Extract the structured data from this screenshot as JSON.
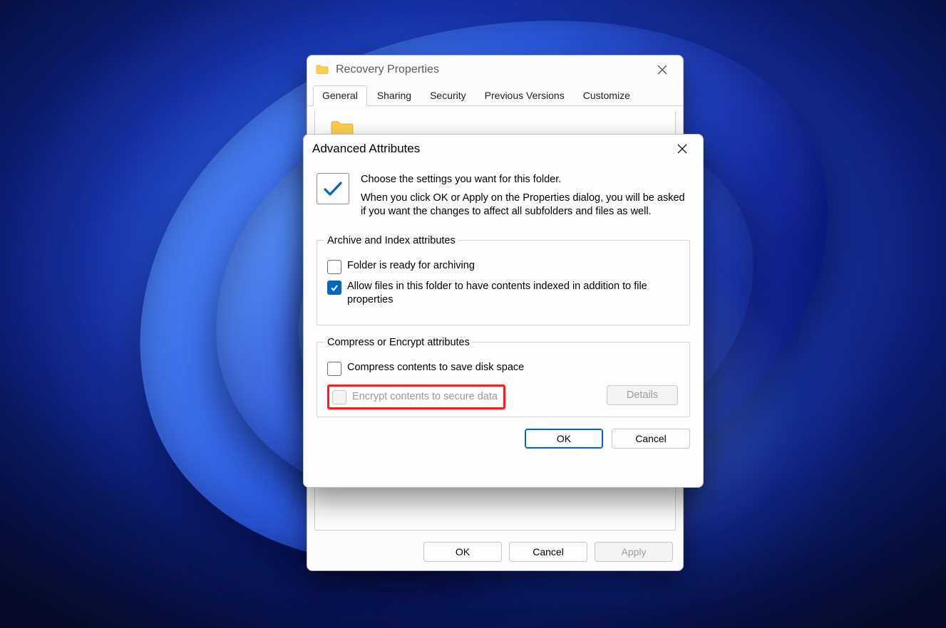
{
  "properties": {
    "title": "Recovery Properties",
    "tabs": [
      "General",
      "Sharing",
      "Security",
      "Previous Versions",
      "Customize"
    ],
    "selected_tab": "General",
    "buttons": {
      "ok": "OK",
      "cancel": "Cancel",
      "apply": "Apply"
    }
  },
  "advanced": {
    "title": "Advanced Attributes",
    "intro_line1": "Choose the settings you want for this folder.",
    "intro_line2": "When you click OK or Apply on the Properties dialog, you will be asked if you want the changes to affect all subfolders and files as well.",
    "group1_title": "Archive and Index attributes",
    "chk_archive": {
      "label": "Folder is ready for archiving",
      "checked": false
    },
    "chk_index": {
      "label": "Allow files in this folder to have contents indexed in addition to file properties",
      "checked": true
    },
    "group2_title": "Compress or Encrypt attributes",
    "chk_compress": {
      "label": "Compress contents to save disk space",
      "checked": false
    },
    "chk_encrypt": {
      "label": "Encrypt contents to secure data",
      "checked": false,
      "disabled": true
    },
    "details_btn": "Details",
    "buttons": {
      "ok": "OK",
      "cancel": "Cancel"
    }
  }
}
